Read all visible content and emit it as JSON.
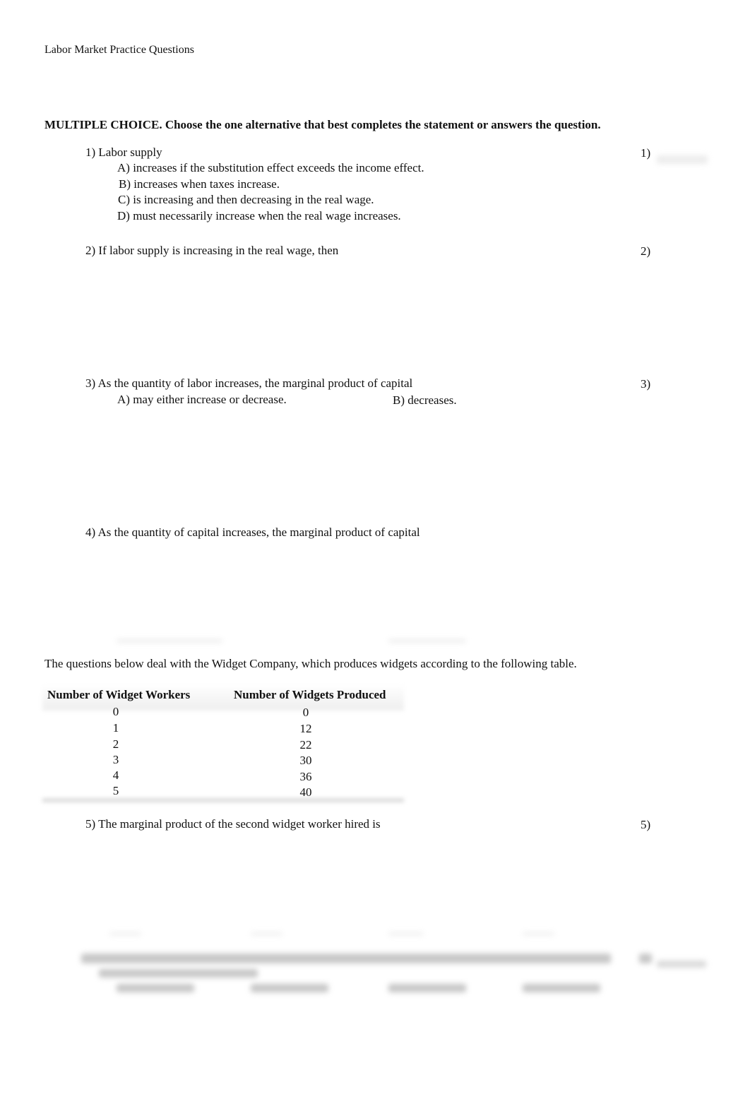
{
  "header": {
    "title": "Labor Market Practice Questions"
  },
  "instructions": "MULTIPLE CHOICE.  Choose the one alternative that best completes the statement or answers the question.",
  "questions": [
    {
      "stem": "1) Labor supply",
      "answer_label": "1)",
      "options": [
        "A) increases if the substitution effect exceeds the income effect.",
        "B) increases when taxes increase.",
        "C) is increasing and then decreasing in the real wage.",
        "D) must necessarily increase when the real wage increases."
      ]
    },
    {
      "stem": "2) If labor supply is increasing in the real wage, then",
      "answer_label": "2)"
    },
    {
      "stem": "3) As the quantity of labor increases, the marginal product of capital",
      "answer_label": "3)",
      "options": [
        "A) may either increase or decrease.",
        "B) decreases."
      ]
    },
    {
      "stem": "4) As the quantity of capital increases, the marginal product of capital"
    },
    {
      "stem": "5) The marginal product of the second widget worker hired is",
      "answer_label": "5)"
    }
  ],
  "table_intro": "The questions below deal with the Widget Company, which produces widgets according to the following table.",
  "table": {
    "headers": [
      "Number of Widget Workers",
      "Number of Widgets Produced"
    ],
    "rows": [
      [
        "0",
        "0"
      ],
      [
        "1",
        "12"
      ],
      [
        "2",
        "22"
      ],
      [
        "3",
        "30"
      ],
      [
        "4",
        "36"
      ],
      [
        "5",
        "40"
      ]
    ]
  }
}
